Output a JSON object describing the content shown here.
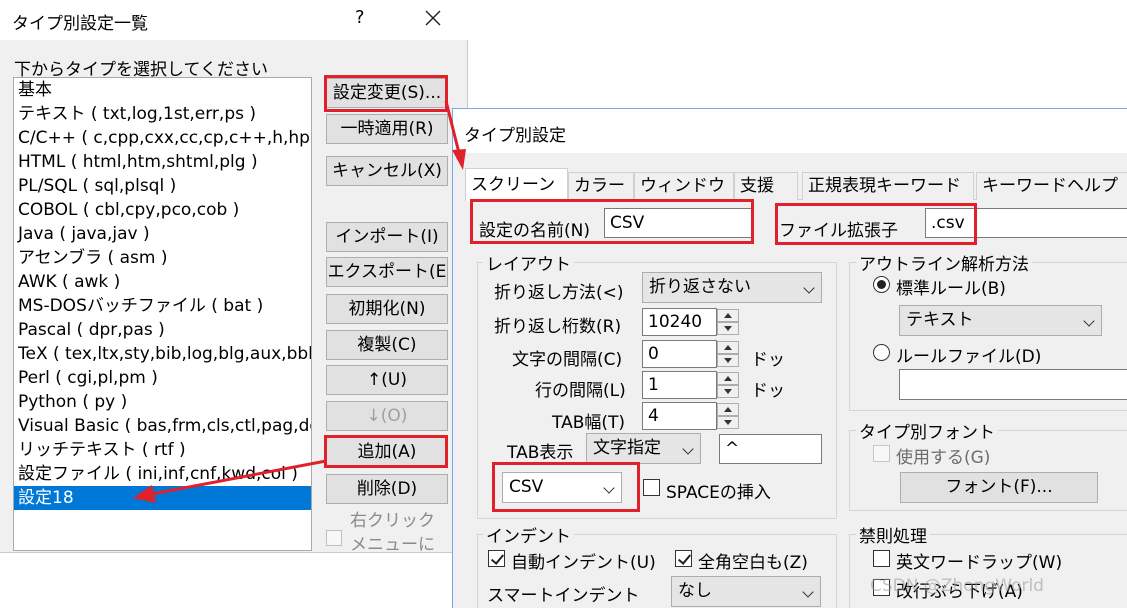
{
  "type_list_dialog": {
    "title": "タイプ別設定一覧",
    "help": "?",
    "prompt": "下からタイプを選択してください",
    "types": [
      "基本",
      "テキスト ( txt,log,1st,err,ps )",
      "C/C++ ( c,cpp,cxx,cc,cp,c++,h,hpp,",
      "HTML ( html,htm,shtml,plg )",
      "PL/SQL ( sql,plsql )",
      "COBOL ( cbl,cpy,pco,cob )",
      "Java ( java,jav )",
      "アセンブラ ( asm )",
      "AWK ( awk )",
      "MS-DOSバッチファイル ( bat )",
      "Pascal ( dpr,pas )",
      "TeX ( tex,ltx,sty,bib,log,blg,aux,bbl,",
      "Perl ( cgi,pl,pm )",
      "Python ( py )",
      "Visual Basic ( bas,frm,cls,ctl,pag,do",
      "リッチテキスト ( rtf )",
      "設定ファイル ( ini,inf,cnf,kwd,col )",
      "設定18"
    ],
    "buttons": {
      "change": "設定変更(S)...",
      "apply_once": "一時適用(R)",
      "cancel": "キャンセル(X)",
      "import": "インポート(I)",
      "export": "エクスポート(E",
      "init": "初期化(N)",
      "duplicate": "複製(C)",
      "up": "↑(U)",
      "down": "↓(O)",
      "add": "追加(A)",
      "delete": "削除(D)"
    },
    "right_click_line1": "右クリック",
    "right_click_line2": "メニューに"
  },
  "type_settings_dialog": {
    "title": "タイプ別設定",
    "tabs": [
      "スクリーン",
      "カラー",
      "ウィンドウ",
      "支援",
      "正規表現キーワード",
      "キーワードヘルプ"
    ],
    "name_label": "設定の名前(N)",
    "name_value": "CSV",
    "ext_label": "ファイル拡張子",
    "ext_value": ".csv",
    "layout": {
      "title": "レイアウト",
      "wrap_method_label": "折り返し方法(<)",
      "wrap_method_value": "折り返さない",
      "wrap_columns_label": "折り返し桁数(R)",
      "wrap_columns_value": "10240",
      "char_spacing_label": "文字の間隔(C)",
      "char_spacing_value": "0",
      "char_spacing_unit": "ドッ",
      "line_spacing_label": "行の間隔(L)",
      "line_spacing_value": "1",
      "line_spacing_unit": "ドッ",
      "tab_width_label": "TAB幅(T)",
      "tab_width_value": "4",
      "tab_display_label": "TAB表示",
      "tab_display_value": "文字指定",
      "tab_char_value": "^",
      "mode_value": "CSV",
      "space_insert_label": "SPACEの挿入"
    },
    "outline": {
      "title": "アウトライン解析方法",
      "standard_rule_label": "標準ルール(B)",
      "standard_rule_value": "テキスト",
      "rule_file_label": "ルールファイル(D)"
    },
    "font": {
      "title": "タイプ別フォント",
      "use_label": "使用する(G)",
      "button": "フォント(F)..."
    },
    "indent": {
      "title": "インデント",
      "auto_indent_label": "自動インデント(U)",
      "fullwidth_space_label": "全角空白も(Z)",
      "smart_indent_label": "スマートインデント",
      "smart_indent_value": "なし"
    },
    "kinsoku": {
      "title": "禁則処理",
      "word_wrap_label": "英文ワードラップ(W)",
      "line_end_label": "改行ぶら下げ(A)"
    }
  },
  "watermark": "CSDN @ZhongWorld",
  "colors": {
    "highlight": "#e0212c",
    "selection": "#0078d7"
  }
}
